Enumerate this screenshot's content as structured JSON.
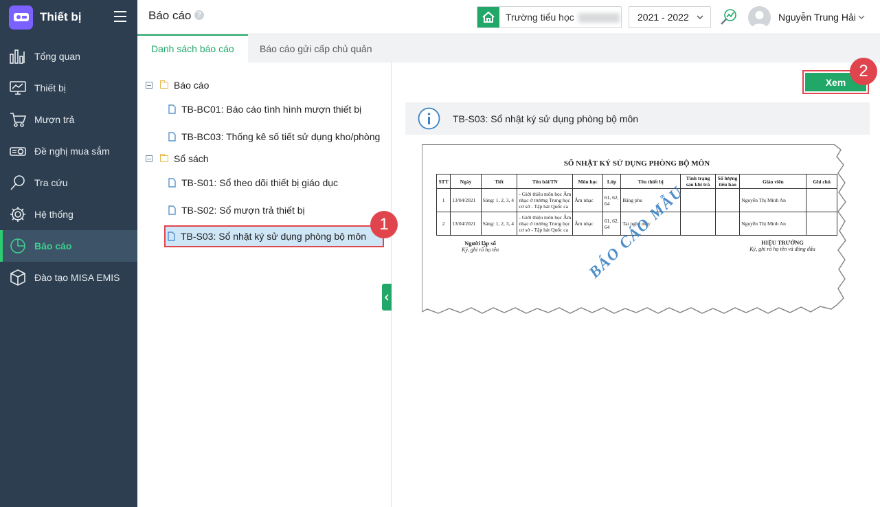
{
  "app": {
    "brand_title": "Thiết bị"
  },
  "sidebar": {
    "items": [
      {
        "label": "Tổng quan",
        "icon": "bar-chart-icon",
        "active": false
      },
      {
        "label": "Thiết bị",
        "icon": "monitor-icon",
        "active": false
      },
      {
        "label": "Mượn trả",
        "icon": "cart-icon",
        "active": false
      },
      {
        "label": "Đề nghị mua sắm",
        "icon": "projector-icon",
        "active": false
      },
      {
        "label": "Tra cứu",
        "icon": "search-icon",
        "active": false
      },
      {
        "label": "Hệ thống",
        "icon": "gear-icon",
        "active": false
      },
      {
        "label": "Báo cáo",
        "icon": "pie-chart-icon",
        "active": true
      },
      {
        "label": "Đào tạo MISA EMIS",
        "icon": "cube-icon",
        "active": false
      }
    ]
  },
  "header": {
    "title": "Báo cáo",
    "help": "?",
    "school_label": "Trường tiểu học",
    "school_year": "2021 - 2022",
    "user_name": "Nguyễn Trung Hải"
  },
  "tabs": [
    {
      "label": "Danh sách báo cáo",
      "active": true
    },
    {
      "label": "Báo cáo gửi cấp chủ quản",
      "active": false
    }
  ],
  "tree": {
    "groups": [
      {
        "label": "Báo cáo",
        "items": [
          "TB-BC01: Báo cáo tình hình mượn thiết bị",
          "TB-BC03: Thống kê số tiết sử dụng kho/phòng"
        ]
      },
      {
        "label": "Sổ sách",
        "items": [
          "TB-S01: Sổ theo dõi thiết bị giáo dục",
          "TB-S02: Sổ mượn trả thiết bị",
          "TB-S03: Sổ nhật ký sử dụng phòng bộ môn"
        ]
      }
    ],
    "selected": "TB-S03: Sổ nhật ký sử dụng phòng bộ môn"
  },
  "content": {
    "view_button": "Xem",
    "info_text": "TB-S03: Sổ nhật ký sử dụng phòng bộ môn",
    "badges": [
      "1",
      "2"
    ]
  },
  "preview": {
    "title": "SỔ NHẬT KÝ SỬ DỤNG PHÒNG BỘ MÔN",
    "watermark": "BÁO CÁO MẪU",
    "columns": [
      "STT",
      "Ngày",
      "Tiết",
      "Tên bài/TN",
      "Môn học",
      "Lớp",
      "Tên thiết bị",
      "Tình trạng sau khi trả",
      "Số lượng tiêu hao",
      "Giáo viên",
      "Ghi chú"
    ],
    "rows": [
      [
        "1",
        "13/04/2021",
        "Sáng: 1, 2, 3, 4",
        "- Giới thiệu môn học Âm nhạc ở trường Trung học cơ sở - Tập hát Quốc ca",
        "Âm nhạc",
        "61, 62, 64",
        "Băng phu",
        "",
        "",
        "Nguyễn Thị Minh An",
        ""
      ],
      [
        "2",
        "13/04/2021",
        "Sáng: 1, 2, 3, 4",
        "- Giới thiệu môn học Âm nhạc ở trường Trung học cơ sở - Tập hát Quốc ca",
        "Âm nhạc",
        "61, 62, 64",
        "Tai nghe máy",
        "",
        "",
        "Nguyễn Thị Minh An",
        ""
      ]
    ],
    "sign_left_title": "Người lập sổ",
    "sign_left_note": "Ký, ghi rõ họ tên",
    "sign_right_title": "HIỆU TRƯỞNG",
    "sign_right_note": "Ký, ghi rõ họ tên và đóng dấu"
  },
  "colors": {
    "sidebar": "#2c3e50",
    "accent": "#21a869",
    "highlight": "#e0454d"
  }
}
